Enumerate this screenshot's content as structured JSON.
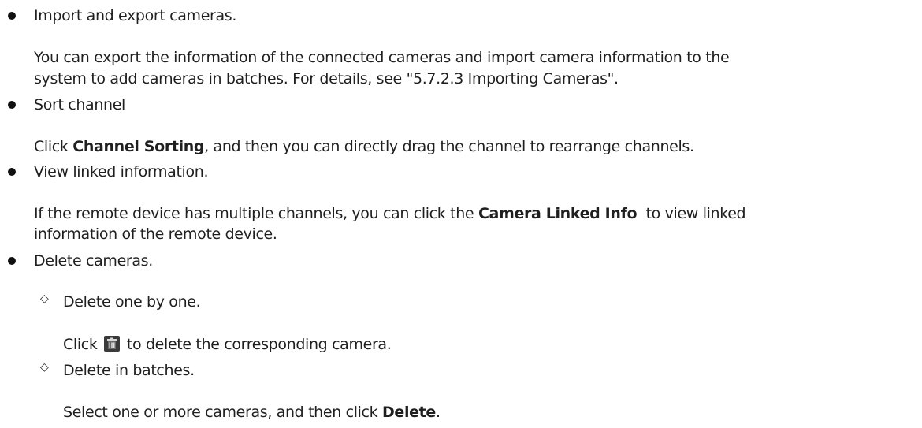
{
  "items": [
    {
      "title": "Import and export cameras.",
      "body_line1": "You can export the information of the connected cameras and import camera information to the",
      "body_line2": "system to add cameras in batches. For details, see \"5.7.2.3 Importing Cameras\"."
    },
    {
      "title": "Sort channel",
      "body_prefix": "Click ",
      "body_bold": "Channel Sorting",
      "body_suffix": ", and then you can directly drag the channel to rearrange channels."
    },
    {
      "title": "View linked information.",
      "body_prefix": "If the remote device has multiple channels, you can click the ",
      "body_bold": "Camera Linked Info",
      "body_suffix": "  to view linked",
      "body_line2": "information of the remote device."
    },
    {
      "title": "Delete cameras.",
      "subitems": [
        {
          "title": "Delete one by one.",
          "body_prefix": "Click ",
          "icon": "trash-icon",
          "body_suffix": " to delete the corresponding camera."
        },
        {
          "title": "Delete in batches.",
          "body_prefix": "Select one or more cameras, and then click ",
          "body_bold": "Delete",
          "body_suffix": "."
        }
      ]
    }
  ]
}
